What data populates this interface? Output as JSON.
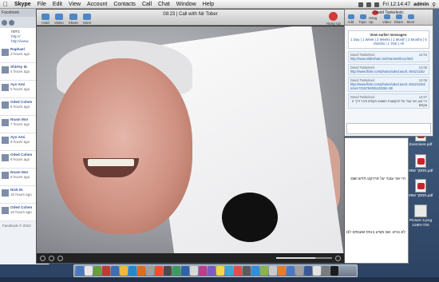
{
  "menubar": {
    "app": "Skype",
    "items": [
      "File",
      "Edit",
      "View",
      "Account",
      "Contacts",
      "Call",
      "Chat",
      "Window",
      "Help"
    ],
    "clock": "Fri 12:14:47",
    "user": "admin"
  },
  "browser": {
    "tab_title": "Facebook",
    "post_line1": "ניתוח: ",
    "post_link": "http://",
    "post_line3": "http://www.",
    "items": [
      {
        "name": "Raphael",
        "sub": "3 hours ago"
      },
      {
        "name": "Shirley M.",
        "sub": "4 hours ago"
      },
      {
        "name": "Ayo Ami",
        "sub": "5 hours ago"
      },
      {
        "name": "Oded Cohen",
        "sub": "6 hours ago"
      },
      {
        "name": "Noam Mor",
        "sub": "7 hours ago"
      },
      {
        "name": "Ayo Ami",
        "sub": "8 hours ago"
      },
      {
        "name": "Oded Cohen",
        "sub": "9 hours ago"
      },
      {
        "name": "Noam Mor",
        "sub": "9 hours ago"
      },
      {
        "name": "Nick M.",
        "sub": "10 hours ago"
      },
      {
        "name": "Oded Cohen",
        "sub": "10 hours ago"
      }
    ],
    "footer": "Facebook © 2010"
  },
  "call": {
    "title": "08:23 | Call with Nir Tober",
    "toolbar": [
      "Hold",
      "Video",
      "Share",
      "More"
    ],
    "hangup": "Hang Up",
    "volume": 0.7
  },
  "chat": {
    "title": "David Tankelevic",
    "toolbar": [
      "Add",
      "Topic",
      "Hang Up",
      "Video",
      "Share",
      "More"
    ],
    "earlier_label": "View earlier messages:",
    "earlier_links": "1 Day | 1 Week | 2 Weeks | 1 Month | 3 Months | 6 Months | 1 Year | All",
    "messages": [
      {
        "who": "David Tankelevic",
        "time": "12:04",
        "text": "http://www.slideshare.net/marwentinov.html",
        "rtl": false
      },
      {
        "who": "David Tankelevic",
        "time": "12:05",
        "text": "http://www.flickr.com/photos/oded.aso/1 4841/1181/",
        "rtl": false
      },
      {
        "who": "David Tankelevic",
        "time": "12:06",
        "text": "http://www.flickr.com/photos/oded.aso/1 4841/1181/in/set-7215784381133263 40/",
        "rtl": false
      },
      {
        "who": "David Tankelevic",
        "time": "12:07",
        "text": "היי נוע, אני עבד על ההקשבה השבוע הקודם ודבר דרך הצקתם",
        "rtl": true
      }
    ]
  },
  "document": {
    "line1": "היי אני עובד על פרויקט חדש ושם",
    "line2": "לא נורא. אם מציע בטיס שעוסים לם"
  },
  "desktop_icons": [
    {
      "label": "Exercises.pdf",
      "type": "pdf"
    },
    {
      "label": "מסמך שפה.pdf",
      "type": "pdf"
    },
    {
      "label": "מסמך שפה.pdf",
      "type": "pdf"
    },
    {
      "label": "Picture 3.png 1280×720",
      "type": "img"
    },
    {
      "label": "Error.doc",
      "type": "doc"
    }
  ],
  "dock_colors": [
    "#4a78c2",
    "#e8e8e8",
    "#6a9e3a",
    "#c13a2f",
    "#3c6db5",
    "#f1b83b",
    "#1e8bd0",
    "#e06b1e",
    "#9f9f9f",
    "#ff4b2b",
    "#4a4a4a",
    "#3a9b5c",
    "#2d64a8",
    "#d8d8d8",
    "#c23a8c",
    "#7e5bc2",
    "#f7d547",
    "#3aa7d8",
    "#e84a4a",
    "#5b5b5b",
    "#2f8fdc",
    "#8ab34a",
    "#c9c9c9",
    "#e97b2b",
    "#4a78c2",
    "#a0a0a0",
    "#3b5998",
    "#e2e2e2",
    "#7b7b7b",
    "#1d1d1d"
  ]
}
